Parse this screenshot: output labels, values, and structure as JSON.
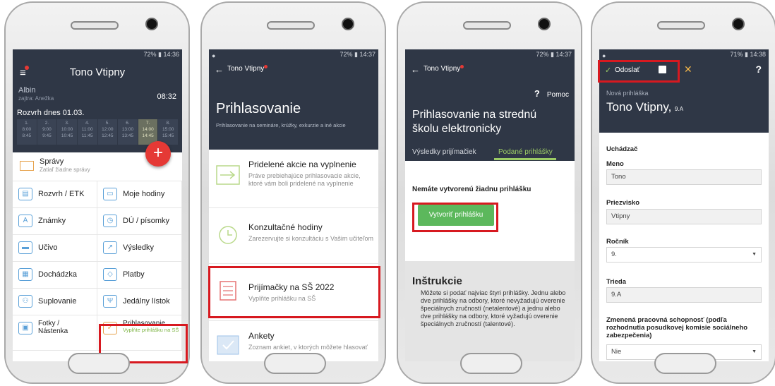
{
  "phone1": {
    "status": "72% ▮ 14:36",
    "title": "Tono Vtipny",
    "user_name": "Albin",
    "user_sub": "zajtra: Anežka",
    "time": "08:32",
    "rozvrh_title": "Rozvrh dnes 01.03.",
    "periods": [
      {
        "n": "1.",
        "t": "8:00\n8:45"
      },
      {
        "n": "2.",
        "t": "9:00\n9:45"
      },
      {
        "n": "3.",
        "t": "10:00\n10:45"
      },
      {
        "n": "4.",
        "t": "11:00\n11:45"
      },
      {
        "n": "5.",
        "t": "12:00\n12:45"
      },
      {
        "n": "6.",
        "t": "13:00\n13:45"
      },
      {
        "n": "7.",
        "t": "14:00\n14:45"
      },
      {
        "n": "8.",
        "t": "15:00\n15:45"
      }
    ],
    "fab": "+",
    "spravy_label": "Správy",
    "spravy_sub": "Zatiaľ žiadne správy",
    "menu": [
      {
        "label": "Rozvrh / ETK",
        "icon": "timetable-icon"
      },
      {
        "label": "Moje hodiny",
        "icon": "book-icon"
      },
      {
        "label": "Známky",
        "icon": "grades-icon"
      },
      {
        "label": "DÚ / písomky",
        "icon": "clock-icon"
      },
      {
        "label": "Učivo",
        "icon": "briefcase-icon"
      },
      {
        "label": "Výsledky",
        "icon": "chart-icon"
      },
      {
        "label": "Dochádzka",
        "icon": "attendance-icon"
      },
      {
        "label": "Platby",
        "icon": "payment-icon"
      },
      {
        "label": "Suplovanie",
        "icon": "substitution-icon"
      },
      {
        "label": "Jedálny lístok",
        "icon": "cutlery-icon"
      }
    ],
    "fotky_label": "Fotky / Nástenka",
    "prihl_label": "Prihlasovanie",
    "prihl_sub": "Vyplňte prihlášku na SŠ"
  },
  "phone2": {
    "status": "72% ▮ 14:37",
    "crumb": "Tono Vtipny",
    "title": "Prihlasovanie",
    "subtitle": "Prihlasovanie na semináre, krúžky, exkurzie a iné akcie",
    "items": [
      {
        "title": "Pridelené akcie na vyplnenie",
        "desc": "Práve prebiehajúce prihlasovacie akcie, ktoré vám boli pridelené na vyplnenie"
      },
      {
        "title": "Konzultačné hodiny",
        "desc": "Zarezervujte si konzultáciu s Vašim učiteľom"
      },
      {
        "title": "Prijímačky na SŠ 2022",
        "desc": "Vyplňte prihlášku na SŠ"
      },
      {
        "title": "Ankety",
        "desc": "Zoznam ankiet, v ktorých môžete hlasovať"
      }
    ]
  },
  "phone3": {
    "status": "72% ▮ 14:37",
    "crumb": "Tono Vtipny",
    "help": "Pomoc",
    "title": "Prihlasovanie na strednú školu elektronicky",
    "tab1": "Výsledky prijímačiek",
    "tab2": "Podané prihlášky",
    "empty": "Nemáte vytvorenú žiadnu prihlášku",
    "button": "Vytvoriť prihlášku",
    "instr_title": "Inštrukcie",
    "instr_body": "Môžete si podať najviac štyri prihlášky. Jednu alebo dve prihlášky na odbory, ktoré nevyžadujú overenie špeciálnych zručností (netalentové) a jednu alebo dve prihlášky na odbory, ktoré vyžadujú overenie špeciálnych zručností (talentové)."
  },
  "phone4": {
    "status": "71% ▮ 14:38",
    "send": "Odoslať",
    "help": "?",
    "cancel": "✕",
    "new_label": "Nová prihláška",
    "name": "Tono Vtipny,",
    "cls": "9.A",
    "section": "Uchádzač",
    "fields": [
      {
        "label": "Meno",
        "value": "Tono",
        "type": "input"
      },
      {
        "label": "Priezvisko",
        "value": "Vtipny",
        "type": "input"
      },
      {
        "label": "Ročník",
        "value": "9.",
        "type": "select"
      },
      {
        "label": "Trieda",
        "value": "9.A",
        "type": "input"
      }
    ],
    "zmena_label": "Zmenená pracovná schopnosť (podľa rozhodnutia posudkovej komisie sociálneho zabezpečenia)",
    "zmena_value": "Nie"
  },
  "colors": {
    "header": "#2f3746",
    "accent_green": "#9ccc65",
    "button_green": "#5cb85c",
    "highlight_red": "#d71920",
    "fab_red": "#e53935"
  }
}
